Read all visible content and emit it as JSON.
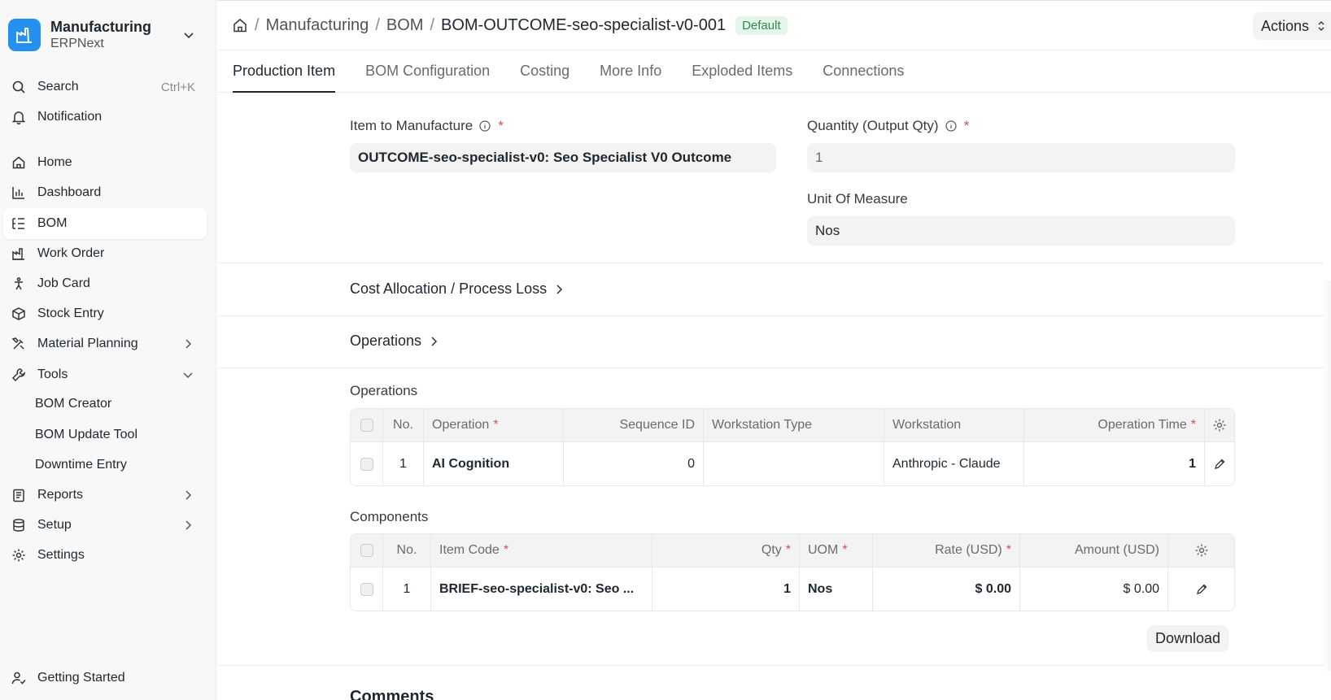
{
  "app": {
    "name": "Manufacturing",
    "sub": "ERPNext",
    "brand_color": "#2490ef"
  },
  "sidebar": {
    "search": {
      "label": "Search",
      "shortcut": "Ctrl+K"
    },
    "notification": "Notification",
    "items": [
      {
        "label": "Home",
        "icon": "home-icon"
      },
      {
        "label": "Dashboard",
        "icon": "bar-chart-icon"
      },
      {
        "label": "BOM",
        "icon": "list-tree-icon"
      },
      {
        "label": "Work Order",
        "icon": "factory-icon"
      },
      {
        "label": "Job Card",
        "icon": "person-icon"
      },
      {
        "label": "Stock Entry",
        "icon": "box-icon"
      },
      {
        "label": "Material Planning",
        "icon": "tools-icon"
      },
      {
        "label": "Tools",
        "icon": "wrench-icon"
      },
      {
        "label": "BOM Creator"
      },
      {
        "label": "BOM Update Tool"
      },
      {
        "label": "Downtime Entry"
      },
      {
        "label": "Reports",
        "icon": "clipboard-icon"
      },
      {
        "label": "Setup",
        "icon": "database-icon"
      },
      {
        "label": "Settings",
        "icon": "gear-icon"
      }
    ],
    "getting_started": "Getting Started"
  },
  "header": {
    "breadcrumb": [
      "Manufacturing",
      "BOM"
    ],
    "title": "BOM-OUTCOME-seo-specialist-v0-001",
    "status": "Default",
    "actions": "Actions"
  },
  "tabs": [
    "Production Item",
    "BOM Configuration",
    "Costing",
    "More Info",
    "Exploded Items",
    "Connections"
  ],
  "form": {
    "item_label": "Item to Manufacture",
    "item_value": "OUTCOME-seo-specialist-v0: Seo Specialist V0 Outcome",
    "qty_label": "Quantity (Output Qty)",
    "qty_value": "1",
    "uom_label": "Unit Of Measure",
    "uom_value": "Nos",
    "required_mark": "*"
  },
  "sections": {
    "cost_allocation": "Cost Allocation / Process Loss",
    "operations": "Operations"
  },
  "operations_table": {
    "title": "Operations",
    "headers": {
      "no": "No.",
      "operation": "Operation",
      "sequence": "Sequence ID",
      "ws_type": "Workstation Type",
      "workstation": "Workstation",
      "time": "Operation Time"
    },
    "rows": [
      {
        "no": "1",
        "operation": "AI Cognition",
        "sequence": "0",
        "ws_type": "",
        "workstation": "Anthropic - Claude",
        "time": "1"
      }
    ]
  },
  "components_table": {
    "title": "Components",
    "headers": {
      "no": "No.",
      "item_code": "Item Code",
      "qty": "Qty",
      "uom": "UOM",
      "rate": "Rate (USD)",
      "amount": "Amount (USD)"
    },
    "rows": [
      {
        "no": "1",
        "item_code": "BRIEF-seo-specialist-v0: Seo ...",
        "qty": "1",
        "uom": "Nos",
        "rate": "$ 0.00",
        "amount": "$ 0.00"
      }
    ]
  },
  "download": "Download",
  "comments": "Comments"
}
